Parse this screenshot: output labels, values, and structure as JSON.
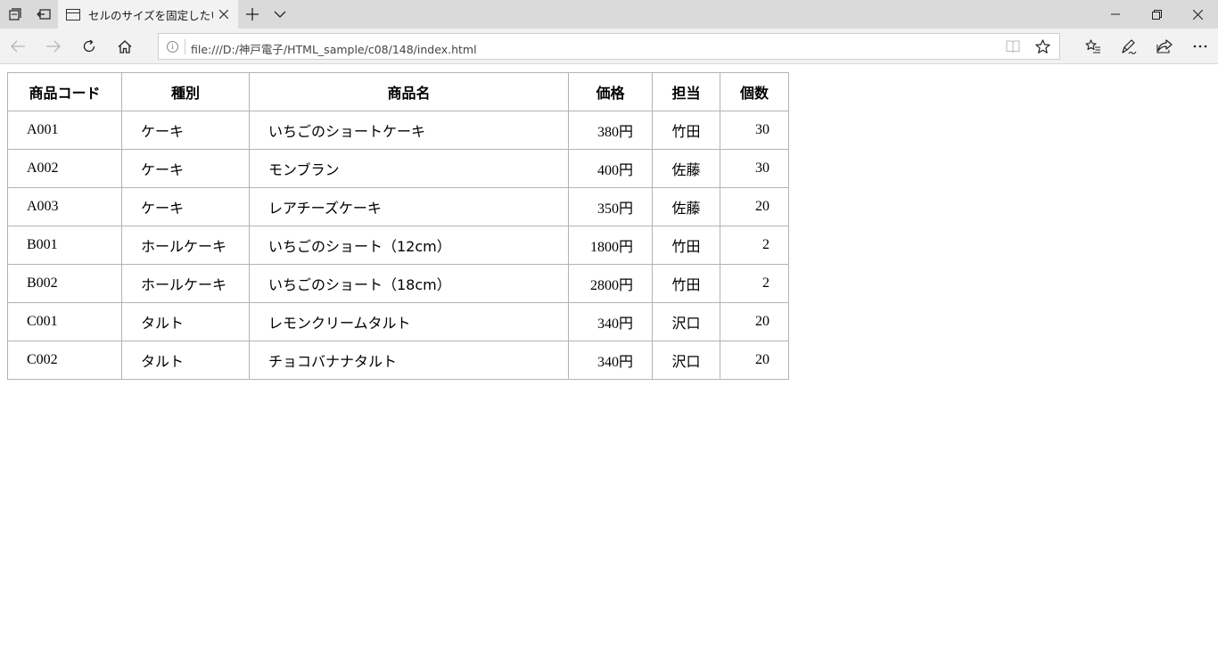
{
  "browser": {
    "tab_title": "セルのサイズを固定したい",
    "url": "file:///D:/神戸電子/HTML_sample/c08/148/index.html"
  },
  "table": {
    "headers": [
      "商品コード",
      "種別",
      "商品名",
      "価格",
      "担当",
      "個数"
    ],
    "rows": [
      {
        "code": "A001",
        "category": "ケーキ",
        "name": "いちごのショートケーキ",
        "price": "380円",
        "person": "竹田",
        "qty": "30"
      },
      {
        "code": "A002",
        "category": "ケーキ",
        "name": "モンブラン",
        "price": "400円",
        "person": "佐藤",
        "qty": "30"
      },
      {
        "code": "A003",
        "category": "ケーキ",
        "name": "レアチーズケーキ",
        "price": "350円",
        "person": "佐藤",
        "qty": "20"
      },
      {
        "code": "B001",
        "category": "ホールケーキ",
        "name": "いちごのショート（12cm）",
        "price": "1800円",
        "person": "竹田",
        "qty": "2"
      },
      {
        "code": "B002",
        "category": "ホールケーキ",
        "name": "いちごのショート（18cm）",
        "price": "2800円",
        "person": "竹田",
        "qty": "2"
      },
      {
        "code": "C001",
        "category": "タルト",
        "name": "レモンクリームタルト",
        "price": "340円",
        "person": "沢口",
        "qty": "20"
      },
      {
        "code": "C002",
        "category": "タルト",
        "name": "チョコバナナタルト",
        "price": "340円",
        "person": "沢口",
        "qty": "20"
      }
    ]
  },
  "icons": {
    "tabs_aside": "tabs-aside-icon",
    "restore_tabs": "restore-tabs-icon",
    "page": "page-icon",
    "close_tab": "close-icon",
    "new_tab": "plus-icon",
    "tab_preview": "chevron-down-icon",
    "minimize": "minimize-icon",
    "maximize": "restore-icon",
    "close_window": "close-icon",
    "back": "back-arrow-icon",
    "forward": "forward-arrow-icon",
    "refresh": "refresh-icon",
    "home": "home-icon",
    "info": "info-icon",
    "reading_view": "reading-view-icon",
    "favorite": "star-icon",
    "favorites_hub": "favorites-hub-icon",
    "web_note": "pen-icon",
    "share": "share-icon",
    "more": "more-icon"
  }
}
